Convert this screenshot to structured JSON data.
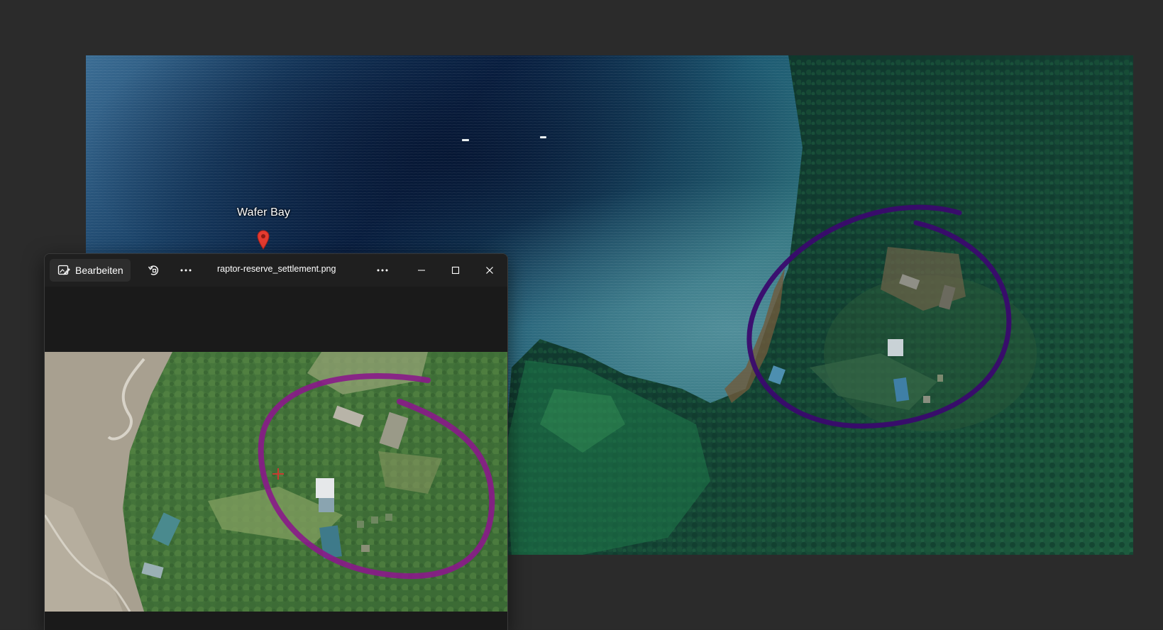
{
  "map": {
    "place_label": "Wafer Bay",
    "pin_icon": "map-pin-icon",
    "annotation_color": "#3a0a6e"
  },
  "photos_window": {
    "edit_label": "Bearbeiten",
    "filename": "raptor-reserve_settlement.png",
    "icons": {
      "edit": "edit-image-icon",
      "rotate": "rotate-icon",
      "more_left": "more-icon",
      "more_right": "more-icon",
      "minimize": "minimize-icon",
      "maximize": "maximize-icon",
      "close": "close-icon"
    },
    "annotation_color": "#8a1a8a"
  }
}
